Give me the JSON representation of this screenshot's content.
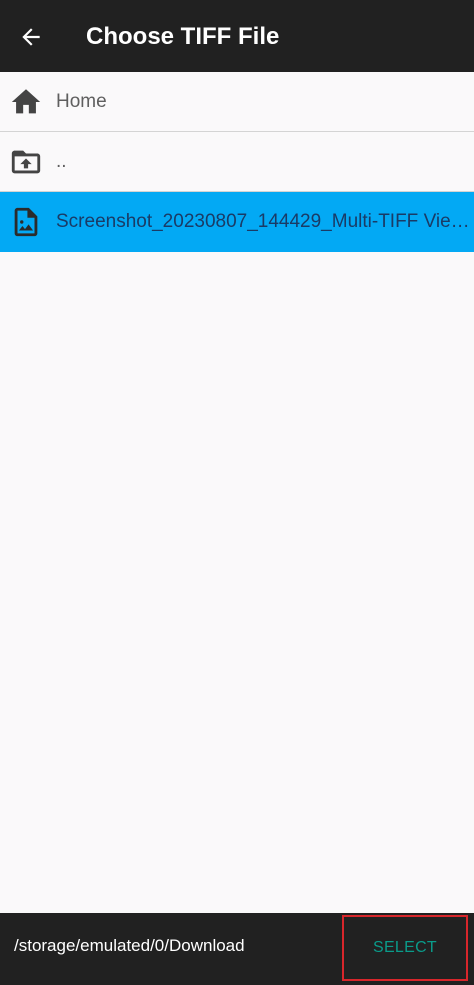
{
  "app_bar": {
    "title": "Choose TIFF File",
    "back_icon": "arrow-left-icon"
  },
  "file_list": [
    {
      "label": "Home",
      "icon": "home-icon",
      "selected": false
    },
    {
      "label": "..",
      "icon": "folder-upload-icon",
      "selected": false
    },
    {
      "label": "Screenshot_20230807_144429_Multi-TIFF Vie…",
      "icon": "image-file-icon",
      "selected": true
    }
  ],
  "bottom_bar": {
    "path": "/storage/emulated/0/Download",
    "select_label": "SELECT"
  },
  "colors": {
    "bar_background": "#212121",
    "selected_row": "#03a9f4",
    "select_text": "#0a9b8a",
    "highlight_border": "#d8262b"
  }
}
